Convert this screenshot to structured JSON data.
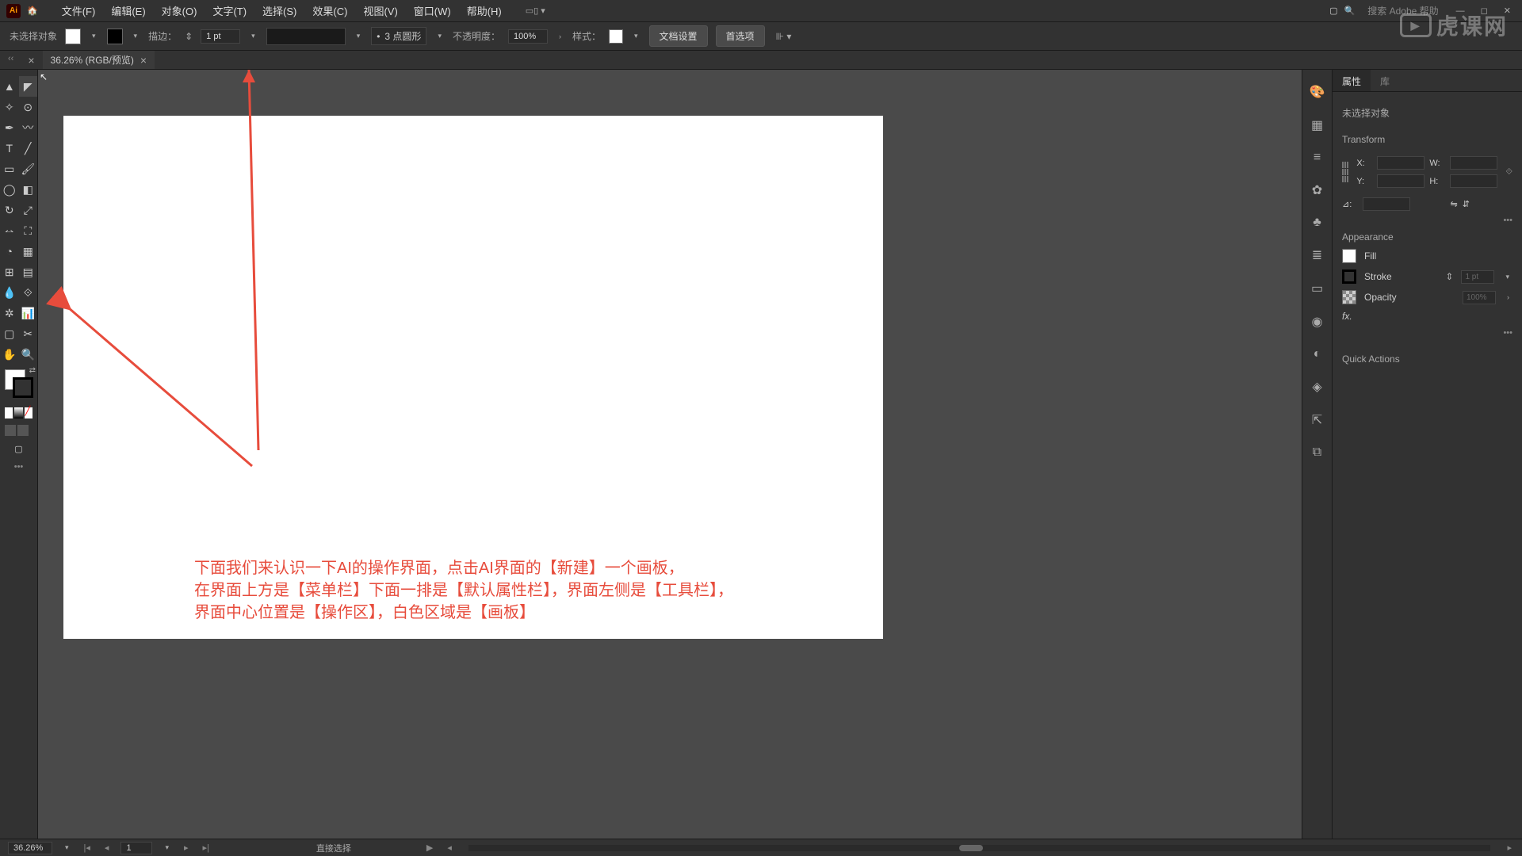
{
  "menubar": {
    "app_abbr": "Ai",
    "items": [
      "文件(F)",
      "编辑(E)",
      "对象(O)",
      "文字(T)",
      "选择(S)",
      "效果(C)",
      "视图(V)",
      "窗口(W)",
      "帮助(H)"
    ],
    "search_placeholder": "搜索 Adobe 帮助"
  },
  "propbar": {
    "no_selection": "未选择对象",
    "stroke_label": "描边：",
    "stroke_value": "1 pt",
    "brush_value": "3 点圆形",
    "opacity_label": "不透明度：",
    "opacity_value": "100%",
    "style_label": "样式：",
    "doc_setup": "文档设置",
    "prefs": "首选项"
  },
  "doc_tab": {
    "title": "36.26% (RGB/预览)"
  },
  "annotation": {
    "line1": "下面我们来认识一下AI的操作界面，点击AI界面的【新建】一个画板，",
    "line2": "在界面上方是【菜单栏】下面一排是【默认属性栏】，界面左侧是【工具栏】，",
    "line3": "界面中心位置是【操作区】，白色区域是【画板】"
  },
  "panels": {
    "tab_props": "属性",
    "tab_lib": "库",
    "no_selection": "未选择对象",
    "transform": "Transform",
    "x_label": "X:",
    "y_label": "Y:",
    "w_label": "W:",
    "h_label": "H:",
    "angle_label": "⊿:",
    "appearance": "Appearance",
    "fill": "Fill",
    "stroke": "Stroke",
    "stroke_val": "1 pt",
    "opacity": "Opacity",
    "opacity_val": "100%",
    "fx": "fx.",
    "quick_actions": "Quick Actions"
  },
  "statusbar": {
    "zoom": "36.26%",
    "artboard_num": "1",
    "tool_hint": "直接选择"
  },
  "watermark": "虎课网"
}
